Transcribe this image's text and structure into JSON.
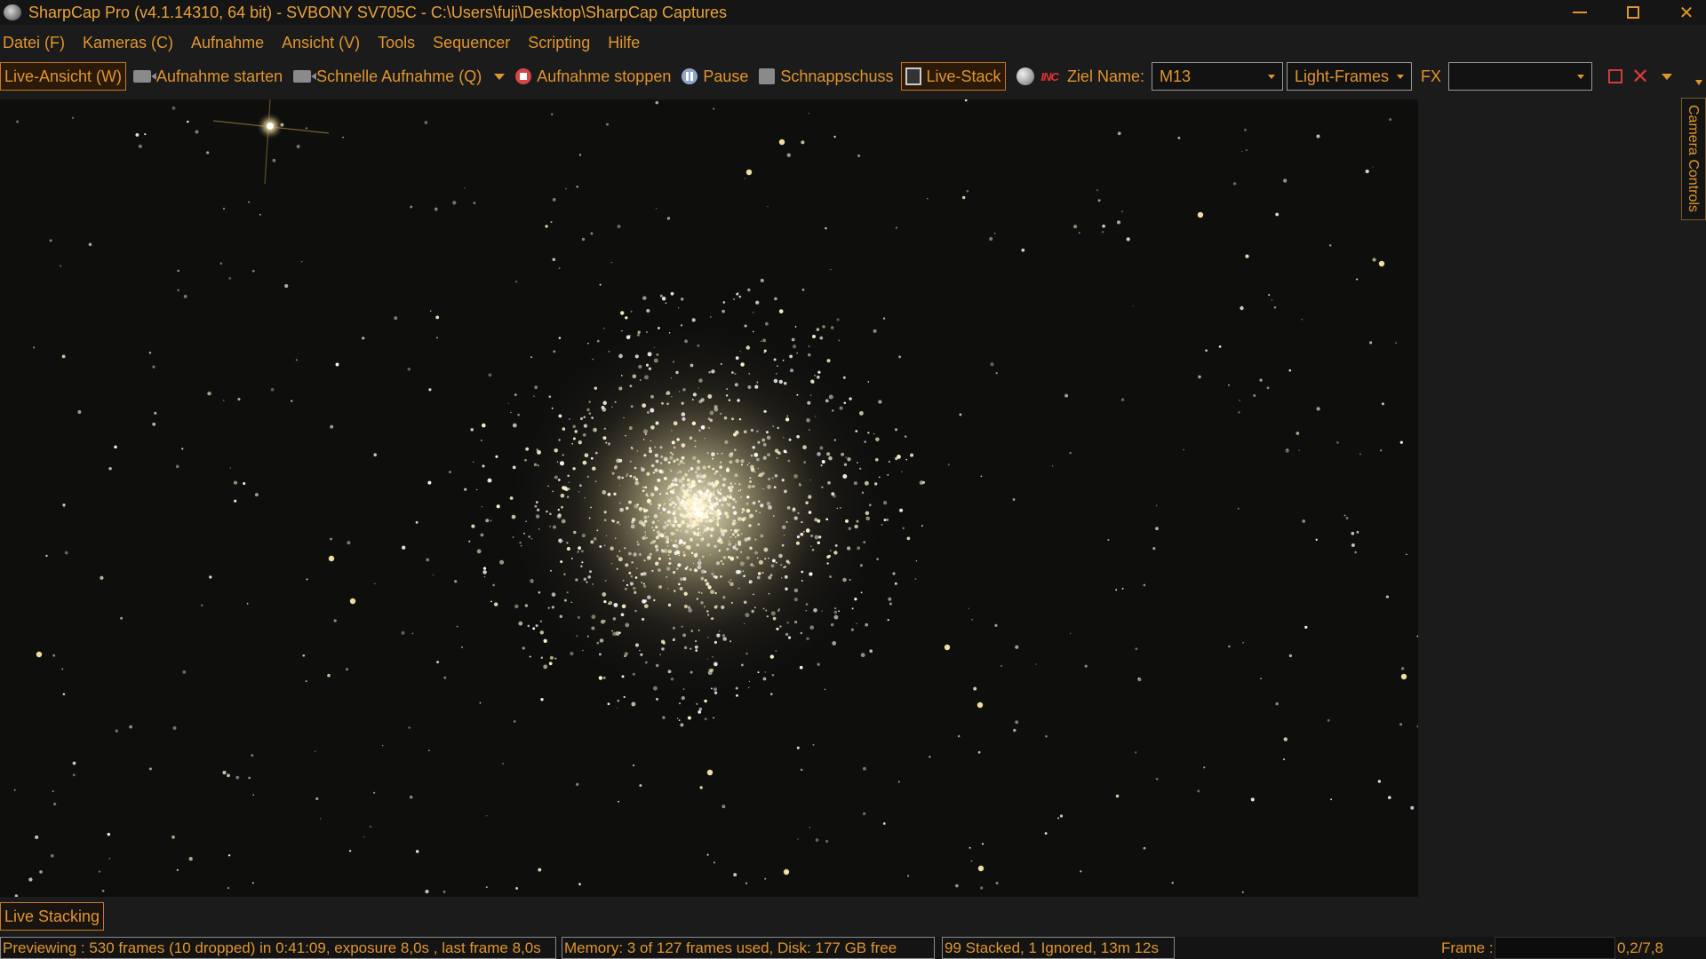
{
  "window": {
    "title": "SharpCap Pro (v4.1.14310, 64 bit) - SVBONY SV705C - C:\\Users\\fuji\\Desktop\\SharpCap Captures",
    "icons": {
      "app": "sharpcap-app-icon",
      "minimize": "minimize-icon",
      "maximize": "maximize-icon",
      "close": "close-icon"
    },
    "close_glyph": "✕"
  },
  "menu": {
    "items": [
      {
        "label": "Datei (F)"
      },
      {
        "label": "Kameras (C)"
      },
      {
        "label": "Aufnahme"
      },
      {
        "label": "Ansicht (V)"
      },
      {
        "label": "Tools"
      },
      {
        "label": "Sequencer"
      },
      {
        "label": "Scripting"
      },
      {
        "label": "Hilfe"
      }
    ]
  },
  "toolbar": {
    "live_view": "Live-Ansicht (W)",
    "start_capture": "Aufnahme starten",
    "quick_capture": "Schnelle Aufnahme (Q)",
    "stop_capture": "Aufnahme stoppen",
    "pause": "Pause",
    "snapshot": "Schnappschuss",
    "live_stack": "Live-Stack",
    "inc_glyph": "INC",
    "target_label": "Ziel Name:",
    "target_value": "M13",
    "frame_type_value": "Light-Frames",
    "fx_label": "FX",
    "fx_value": "",
    "red_x_glyph": "✕",
    "colors": {
      "accent": "#e0952e",
      "active_border": "#c77a1e",
      "stop_red": "#d54646"
    }
  },
  "side_panel": {
    "camera_controls_tab": "Camera Controls"
  },
  "bottom": {
    "live_stacking_tab": "Live Stacking"
  },
  "status": {
    "preview": "Previewing : 530 frames (10 dropped) in 0:41:09, exposure 8,0s , last frame 8,0s",
    "memory": "Memory: 3 of 127 frames used, Disk: 177 GB free",
    "stacked": "99 Stacked, 1 Ignored, 13m 12s",
    "frame_label": "Frame :",
    "frame_value": "0,2/7,8"
  }
}
